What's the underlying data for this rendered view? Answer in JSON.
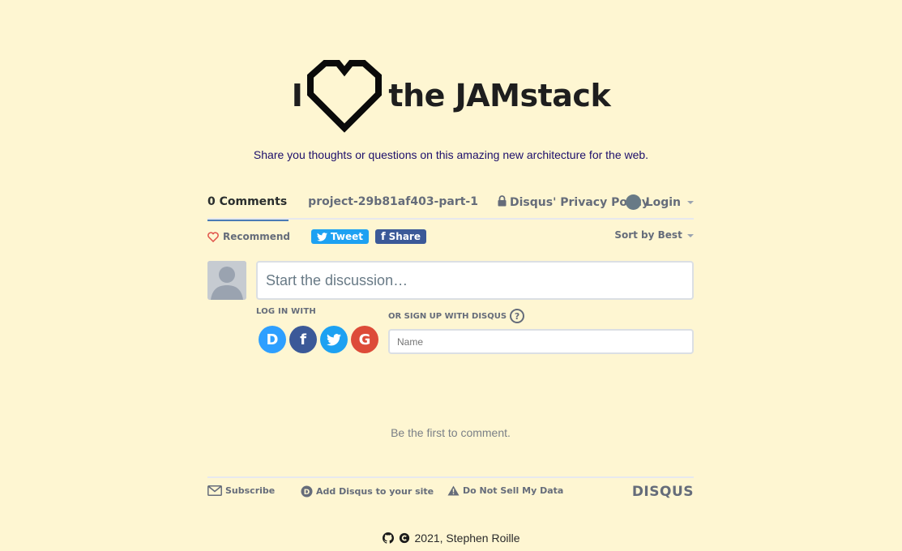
{
  "hero": {
    "left_text": "I",
    "right_text": "the JAMstack",
    "heart_icon": "heart-outline-icon"
  },
  "tagline": "Share you thoughts or questions on this amazing new architecture for the web.",
  "disqus": {
    "nav": {
      "comments_tab": "0 Comments",
      "project_tab": "project-29b81af403-part-1",
      "privacy_tab": "Disqus' Privacy Policy",
      "login": "Login"
    },
    "actions": {
      "recommend": "Recommend",
      "tweet": "Tweet",
      "share": "Share",
      "sort": "Sort by Best"
    },
    "compose": {
      "placeholder": "Start the discussion…",
      "login_with": "LOG IN WITH",
      "signup_with": "OR SIGN UP WITH DISQUS",
      "help": "?",
      "name_placeholder": "Name",
      "social": [
        {
          "label": "D",
          "icon": "disqus-icon"
        },
        {
          "label": "f",
          "icon": "facebook-icon"
        },
        {
          "label": "twitter",
          "icon": "twitter-icon"
        },
        {
          "label": "G",
          "icon": "google-icon"
        }
      ]
    },
    "empty_message": "Be the first to comment.",
    "footer": {
      "subscribe": "Subscribe",
      "add_disqus": "Add Disqus to your site",
      "do_not_sell": "Do Not Sell My Data",
      "brand": "DISQUS"
    }
  },
  "site_footer": {
    "text": "2021, Stephen Roille"
  },
  "colors": {
    "background": "#fef6d2",
    "tagline": "#1c0f6b",
    "tweet": "#1da1f2",
    "facebook": "#3b5998",
    "disqus_blue": "#2e9fff",
    "google": "#dd4b39"
  }
}
